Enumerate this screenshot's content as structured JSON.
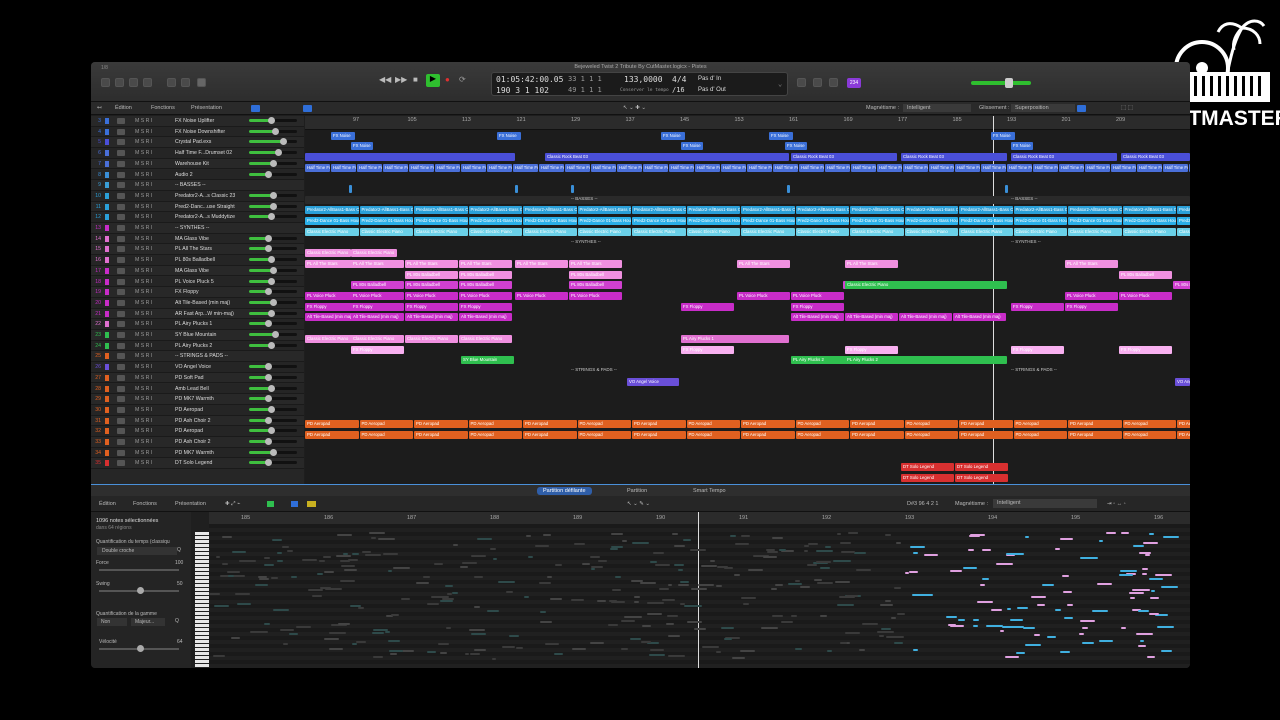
{
  "window": {
    "title": "Bejeweled Twist 2 Tribute By CutMaster.logicx - Pistes",
    "top_left_label": "1/8"
  },
  "logo": {
    "text": "CUTMASTER"
  },
  "transport": {
    "position": "01:05:42:00.05",
    "bars": "190 3 1 102",
    "beats_a": "33  1  1  1",
    "beats_b": "49  1  1  1",
    "tempo": "133,0000",
    "keep_tempo": "Conserver le tempo",
    "signature": "4/4",
    "division": "/16",
    "pass_in": "Pas d' In",
    "pass_out": "Pas d' Out",
    "cpu_badge": "234"
  },
  "toolbar": {
    "edition": "Édition",
    "functions": "Fonctions",
    "presentation": "Présentation",
    "magnetism_label": "Magnétisme :",
    "magnetism_value": "Intelligent",
    "drag_label": "Glissement :",
    "drag_value": "Superposition"
  },
  "ruler_marks": [
    "97",
    "105",
    "113",
    "121",
    "129",
    "137",
    "145",
    "153",
    "161",
    "169",
    "177",
    "185",
    "193",
    "201",
    "209"
  ],
  "tracks": [
    {
      "num": "3",
      "name": "FX Noise Uplifter",
      "fill": 0.45,
      "color": "#3a6fd8"
    },
    {
      "num": "4",
      "name": "FX Noise Downshifter",
      "fill": 0.55,
      "color": "#3a6fd8"
    },
    {
      "num": "5",
      "name": "Crystal Pad.exs",
      "fill": 0.7,
      "color": "#4a4fd8"
    },
    {
      "num": "6",
      "name": "Half Time F...Drumset 02",
      "fill": 0.6,
      "color": "#4a6fd8"
    },
    {
      "num": "7",
      "name": "Warehouse Kit",
      "fill": 0.5,
      "color": "#4a6fd8"
    },
    {
      "num": "8",
      "name": "Audio 2",
      "fill": 0.4,
      "color": "#3a8fd8"
    },
    {
      "num": "9",
      "name": "-- BASSES --",
      "fill": 0.0,
      "color": "#3a9fd8"
    },
    {
      "num": "10",
      "name": "Predator2-A...s Classic 23",
      "fill": 0.5,
      "color": "#2a9fd8"
    },
    {
      "num": "11",
      "name": "Pred2-Danc...use Straight",
      "fill": 0.5,
      "color": "#2a9fd8"
    },
    {
      "num": "12",
      "name": "Predator2-A...s Muddytize",
      "fill": 0.45,
      "color": "#2a9fd8"
    },
    {
      "num": "13",
      "name": "-- SYNTHES --",
      "fill": 0.0,
      "color": "#c82cc8"
    },
    {
      "num": "14",
      "name": "MA Glass Vibe",
      "fill": 0.4,
      "color": "#e070d0"
    },
    {
      "num": "15",
      "name": "PL All The Stars",
      "fill": 0.4,
      "color": "#e070d0"
    },
    {
      "num": "16",
      "name": "PL 80s Balladbell",
      "fill": 0.45,
      "color": "#e070d0"
    },
    {
      "num": "17",
      "name": "MA Glass Vibe",
      "fill": 0.5,
      "color": "#c82cc8"
    },
    {
      "num": "18",
      "name": "PL Voice Pluck 5",
      "fill": 0.45,
      "color": "#c82cc8"
    },
    {
      "num": "19",
      "name": "FX Floppy",
      "fill": 0.4,
      "color": "#c82cc8"
    },
    {
      "num": "20",
      "name": "Alt Tile-Based (min maj)",
      "fill": 0.5,
      "color": "#c82cc8"
    },
    {
      "num": "21",
      "name": "AR Fast Arp...W min-maj)",
      "fill": 0.45,
      "color": "#c82cc8"
    },
    {
      "num": "22",
      "name": "PL Airy Plucks 1",
      "fill": 0.4,
      "color": "#e070d0"
    },
    {
      "num": "23",
      "name": "SY Blue Mountain",
      "fill": 0.55,
      "color": "#2fbf4f"
    },
    {
      "num": "24",
      "name": "PL Airy Plucks 2",
      "fill": 0.45,
      "color": "#2fbf4f"
    },
    {
      "num": "25",
      "name": "-- STRINGS & PADS --",
      "fill": 0.0,
      "color": "#e06020"
    },
    {
      "num": "26",
      "name": "VO Angel Voice",
      "fill": 0.4,
      "color": "#6a4fd8"
    },
    {
      "num": "27",
      "name": "PD Soft Pad",
      "fill": 0.4,
      "color": "#e06020"
    },
    {
      "num": "28",
      "name": "Amb Lead Bell",
      "fill": 0.45,
      "color": "#e06020"
    },
    {
      "num": "29",
      "name": "PD MK7 Warmth",
      "fill": 0.4,
      "color": "#e06020"
    },
    {
      "num": "30",
      "name": "PD Aeropad",
      "fill": 0.45,
      "color": "#e06020"
    },
    {
      "num": "31",
      "name": "PD Ash Choir 2",
      "fill": 0.4,
      "color": "#e06020"
    },
    {
      "num": "32",
      "name": "PD Aeropad",
      "fill": 0.45,
      "color": "#e06020"
    },
    {
      "num": "33",
      "name": "PD Ash Choir 2",
      "fill": 0.4,
      "color": "#e06020"
    },
    {
      "num": "34",
      "name": "PD MK7 Warmth",
      "fill": 0.5,
      "color": "#e06020"
    },
    {
      "num": "35",
      "name": "DT Solo Legend",
      "fill": 0.4,
      "color": "#d83030"
    }
  ],
  "region_labels": {
    "fx_noise": "FX Noise",
    "classic_rock": "Classic Rock Beat 03",
    "half_time": "Half Time Funk",
    "basses_marker": "-- BASSES --",
    "classic_piano": "Classic Electric Piano",
    "pred_classic": "Predator2-AllBass1-Bass Classic 23",
    "pred_dance": "Pred2-Dance 01-Bass House Straight",
    "synthes_marker": "-- SYNTHES --",
    "all_stars": "PL All The Stars",
    "balladbell": "PL 80s Balladbell",
    "voice_pluck": "PL Voice Pluck",
    "floppy": "FX Floppy",
    "tile_based": "Alt Tile-Based (min maj)",
    "airy1": "PL Airy Plucks 1",
    "airy2": "PL Airy Plucks 2",
    "blue_mountain": "SY Blue Mountain",
    "strings_marker": "-- STRINGS & PADS --",
    "angel_voice": "VO Angel Voice",
    "aeropad": "PD Aeropad",
    "solo_legend": "DT Solo Legend"
  },
  "editor": {
    "tabs": [
      "Partition défilante",
      "Partition",
      "Smart Tempo"
    ],
    "edition": "Édition",
    "functions": "Fonctions",
    "presentation": "Présentation",
    "note_info": "D#3  96 4 2 1",
    "magnetism_label": "Magnétisme :",
    "magnetism_value": "Intelligent",
    "selected_notes": "1096 notes sélectionnées",
    "selected_sub": "dans 64 régions",
    "quant_label": "Quantification du temps (classiqu",
    "quant_value": "Double croche",
    "force_label": "Force",
    "force_value": "100",
    "swing_label": "Swing",
    "swing_value": "50",
    "scale_label": "Quantification de la gamme",
    "scale_a": "Non",
    "scale_b": "Majeur...",
    "velocity_label": "Vélocité",
    "velocity_value": "64",
    "ruler_marks": [
      "185",
      "186",
      "187",
      "188",
      "189",
      "190",
      "191",
      "192",
      "193",
      "194",
      "195",
      "196"
    ]
  }
}
